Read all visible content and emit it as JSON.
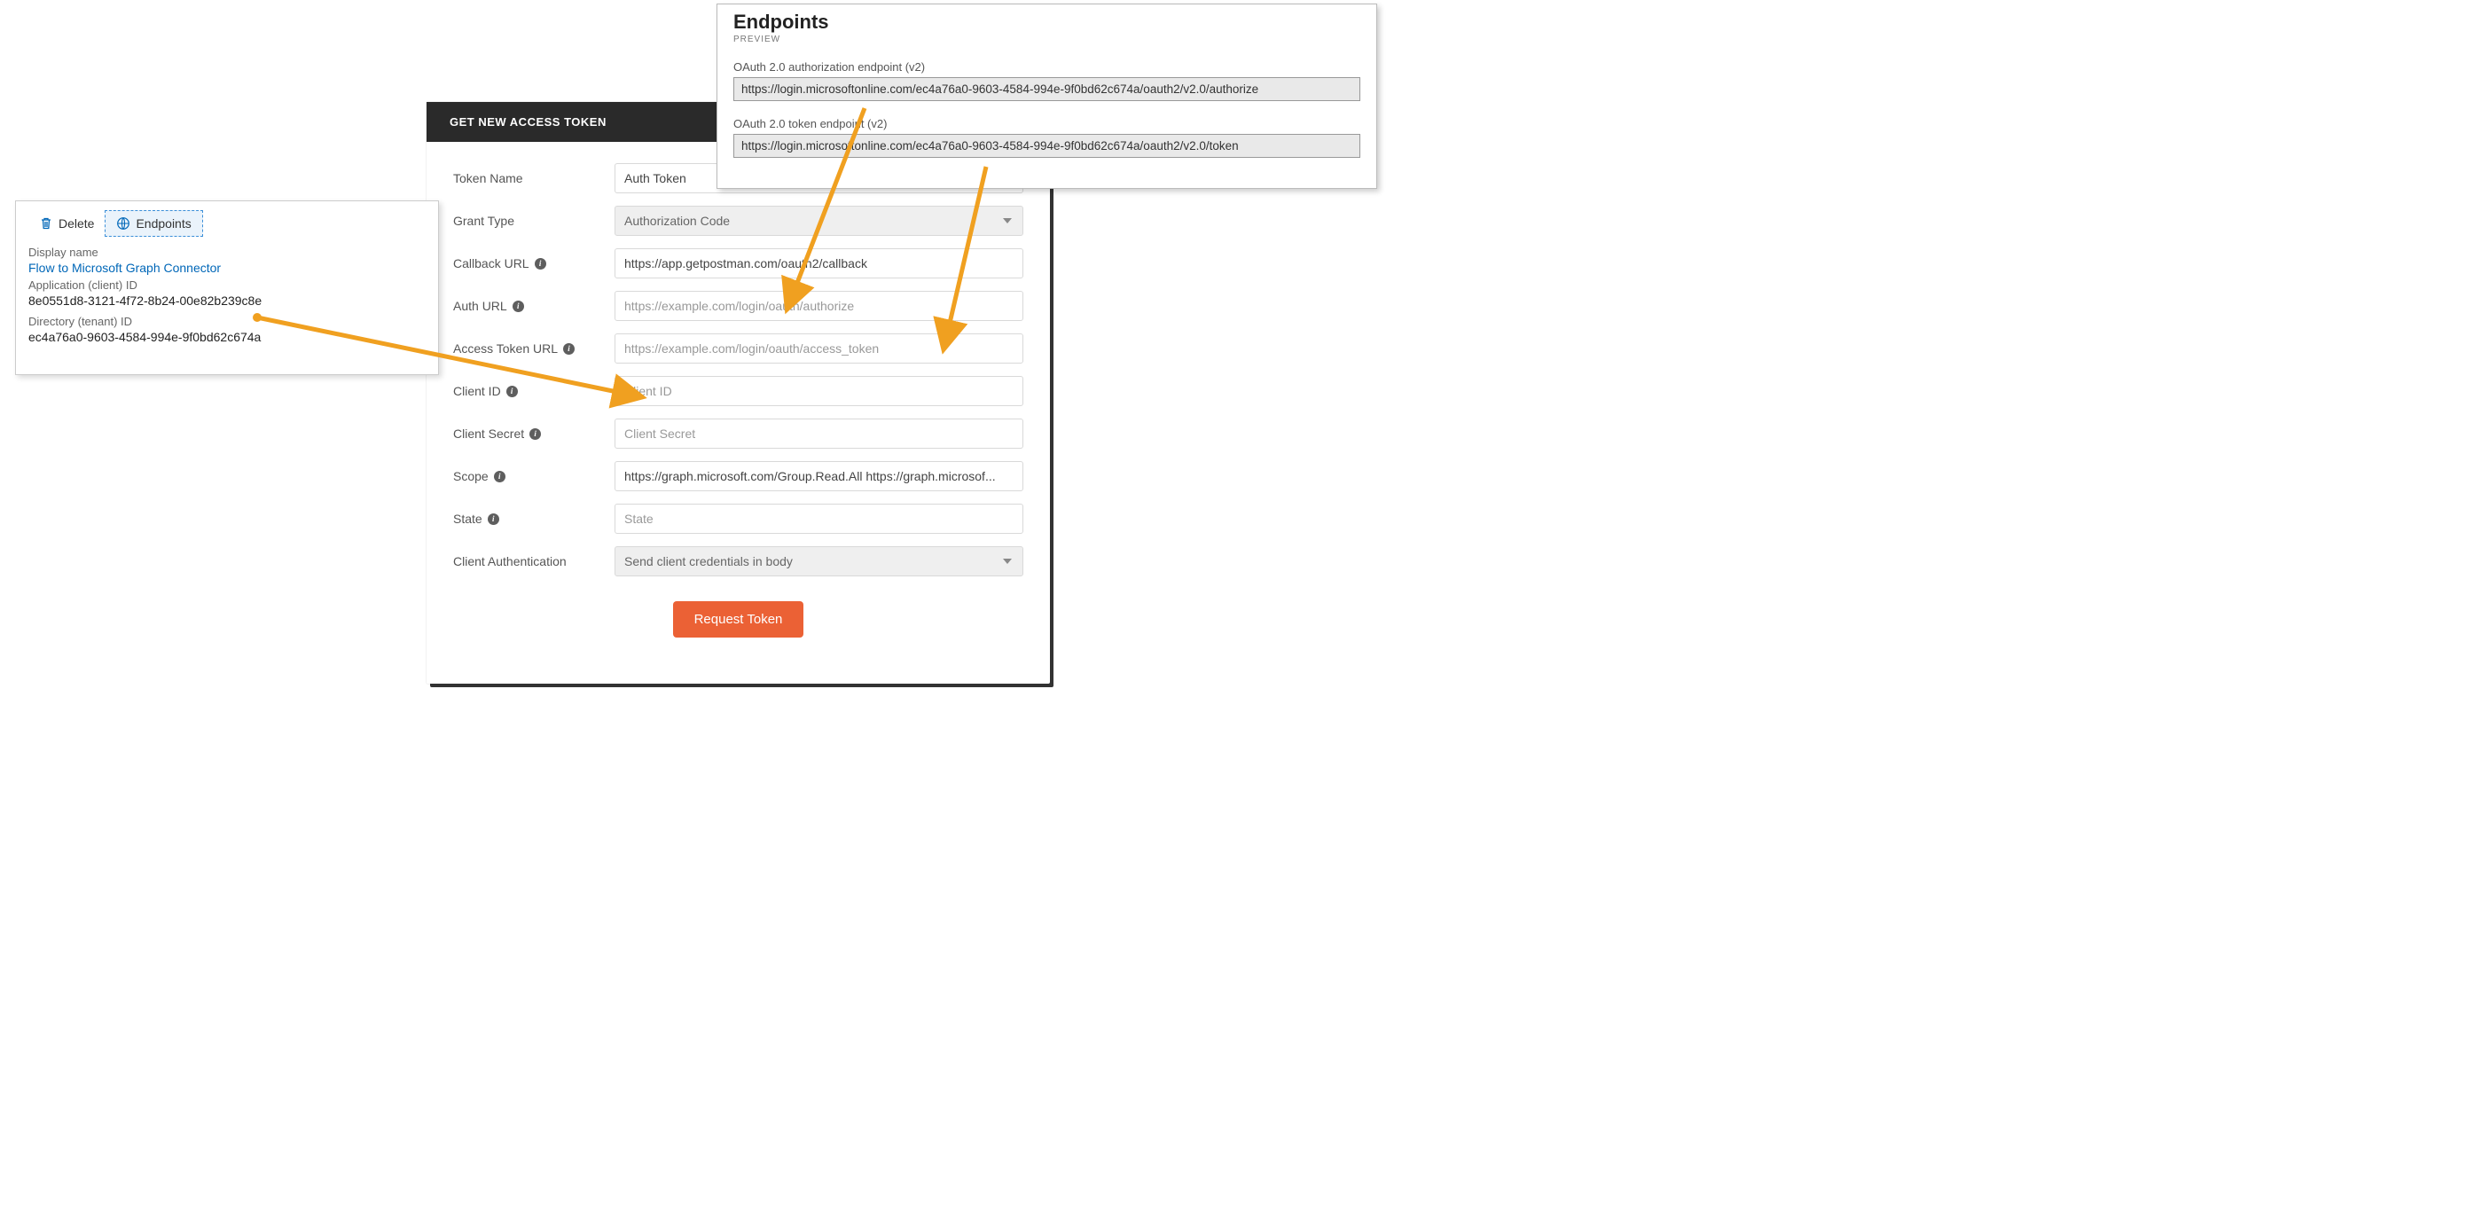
{
  "dialog": {
    "title": "GET NEW ACCESS TOKEN",
    "token_name_label": "Token Name",
    "token_name_value": "Auth Token",
    "grant_type_label": "Grant Type",
    "grant_type_value": "Authorization Code",
    "callback_label": "Callback URL",
    "callback_value": "https://app.getpostman.com/oauth2/callback",
    "auth_url_label": "Auth URL",
    "auth_url_placeholder": "https://example.com/login/oauth/authorize",
    "access_token_url_label": "Access Token URL",
    "access_token_url_placeholder": "https://example.com/login/oauth/access_token",
    "client_id_label": "Client ID",
    "client_id_placeholder": "Client ID",
    "client_secret_label": "Client Secret",
    "client_secret_placeholder": "Client Secret",
    "scope_label": "Scope",
    "scope_value": "https://graph.microsoft.com/Group.Read.All https://graph.microsof...",
    "state_label": "State",
    "state_placeholder": "State",
    "client_auth_label": "Client Authentication",
    "client_auth_value": "Send client credentials in body",
    "request_button": "Request Token"
  },
  "azure": {
    "delete_label": "Delete",
    "endpoints_label": "Endpoints",
    "display_name_label": "Display name",
    "display_name_value": "Flow to Microsoft Graph Connector",
    "client_id_label": "Application (client) ID",
    "client_id_value": "8e0551d8-3121-4f72-8b24-00e82b239c8e",
    "tenant_id_label": "Directory (tenant) ID",
    "tenant_id_value": "ec4a76a0-9603-4584-994e-9f0bd62c674a"
  },
  "endpoints": {
    "title": "Endpoints",
    "subtitle": "PREVIEW",
    "auth_label": "OAuth 2.0 authorization endpoint (v2)",
    "auth_value": "https://login.microsoftonline.com/ec4a76a0-9603-4584-994e-9f0bd62c674a/oauth2/v2.0/authorize",
    "token_label": "OAuth 2.0 token endpoint (v2)",
    "token_value": "https://login.microsoftonline.com/ec4a76a0-9603-4584-994e-9f0bd62c674a/oauth2/v2.0/token"
  },
  "info_glyph": "i"
}
